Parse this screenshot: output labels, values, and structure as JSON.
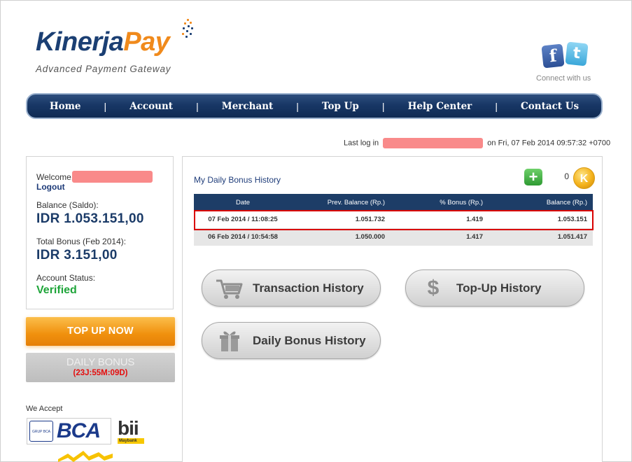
{
  "brand": {
    "name_part1": "Kinerja",
    "name_part2": "Pay",
    "tagline": "Advanced Payment Gateway"
  },
  "social": {
    "facebook_glyph": "f",
    "twitter_glyph": "t",
    "connect_label": "Connect with us"
  },
  "nav": {
    "items": [
      "Home",
      "Account",
      "Merchant",
      "Top Up",
      "Help Center",
      "Contact Us"
    ],
    "separator": "|"
  },
  "lastlog": {
    "prefix": "Last log in",
    "suffix": "on Fri, 07 Feb 2014 09:57:32 +0700"
  },
  "account": {
    "welcome_label": "Welcome,",
    "logout_label": "Logout",
    "balance_label": "Balance (Saldo):",
    "balance_value": "IDR 1.053.151,00",
    "bonus_label": "Total Bonus (Feb 2014):",
    "bonus_value": "IDR 3.151,00",
    "status_label": "Account Status:",
    "status_value": "Verified"
  },
  "actions": {
    "topup_now": "TOP UP NOW",
    "daily_bonus": "DAILY BONUS",
    "daily_bonus_timer": "(23J:55M:09D)"
  },
  "payment": {
    "we_accept": "We Accept",
    "bca_label": "BCA",
    "bca_small": "GRUP BCA",
    "bii_label": "bii",
    "bii_sub": "Maybank"
  },
  "history": {
    "title": "My Daily Bonus History",
    "bonus_count": "0",
    "coin_glyph": "K",
    "columns": [
      "Date",
      "Prev. Balance (Rp.)",
      "% Bonus (Rp.)",
      "Balance (Rp.)"
    ],
    "rows": [
      [
        "07 Feb 2014 / 11:08:25",
        "1.051.732",
        "1.419",
        "1.053.151"
      ],
      [
        "06 Feb 2014 / 10:54:58",
        "1.050.000",
        "1.417",
        "1.051.417"
      ]
    ]
  },
  "buttons": {
    "transaction_history": "Transaction History",
    "topup_history": "Top-Up History",
    "daily_bonus_history": "Daily Bonus History"
  },
  "colors": {
    "navy": "#1b3b68",
    "orange": "#f08a1c",
    "verified_green": "#1fa53a",
    "timer_red": "#e40d0d",
    "highlight_red": "#d90000"
  }
}
